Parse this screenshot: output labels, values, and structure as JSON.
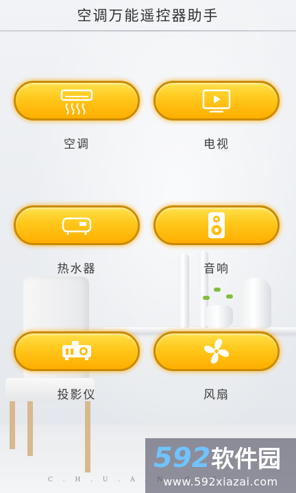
{
  "header": {
    "title": "空调万能遥控器助手"
  },
  "buttons": [
    {
      "id": "ac",
      "label": "空调",
      "icon": "air-conditioner-icon"
    },
    {
      "id": "tv",
      "label": "电视",
      "icon": "tv-icon"
    },
    {
      "id": "heater",
      "label": "热水器",
      "icon": "water-heater-icon"
    },
    {
      "id": "speaker",
      "label": "音响",
      "icon": "speaker-icon"
    },
    {
      "id": "projector",
      "label": "投影仪",
      "icon": "projector-icon"
    },
    {
      "id": "fan",
      "label": "风扇",
      "icon": "fan-icon"
    }
  ],
  "colors": {
    "button_top": "#ffe14a",
    "button_bottom": "#ffae00",
    "button_border": "#c98a00"
  },
  "footer": {
    "letters": "C . H . U . A . N . G . Y"
  },
  "watermark": {
    "brand_digits": "592",
    "brand_text": "软件园",
    "url": "www.592xiazai.com"
  }
}
